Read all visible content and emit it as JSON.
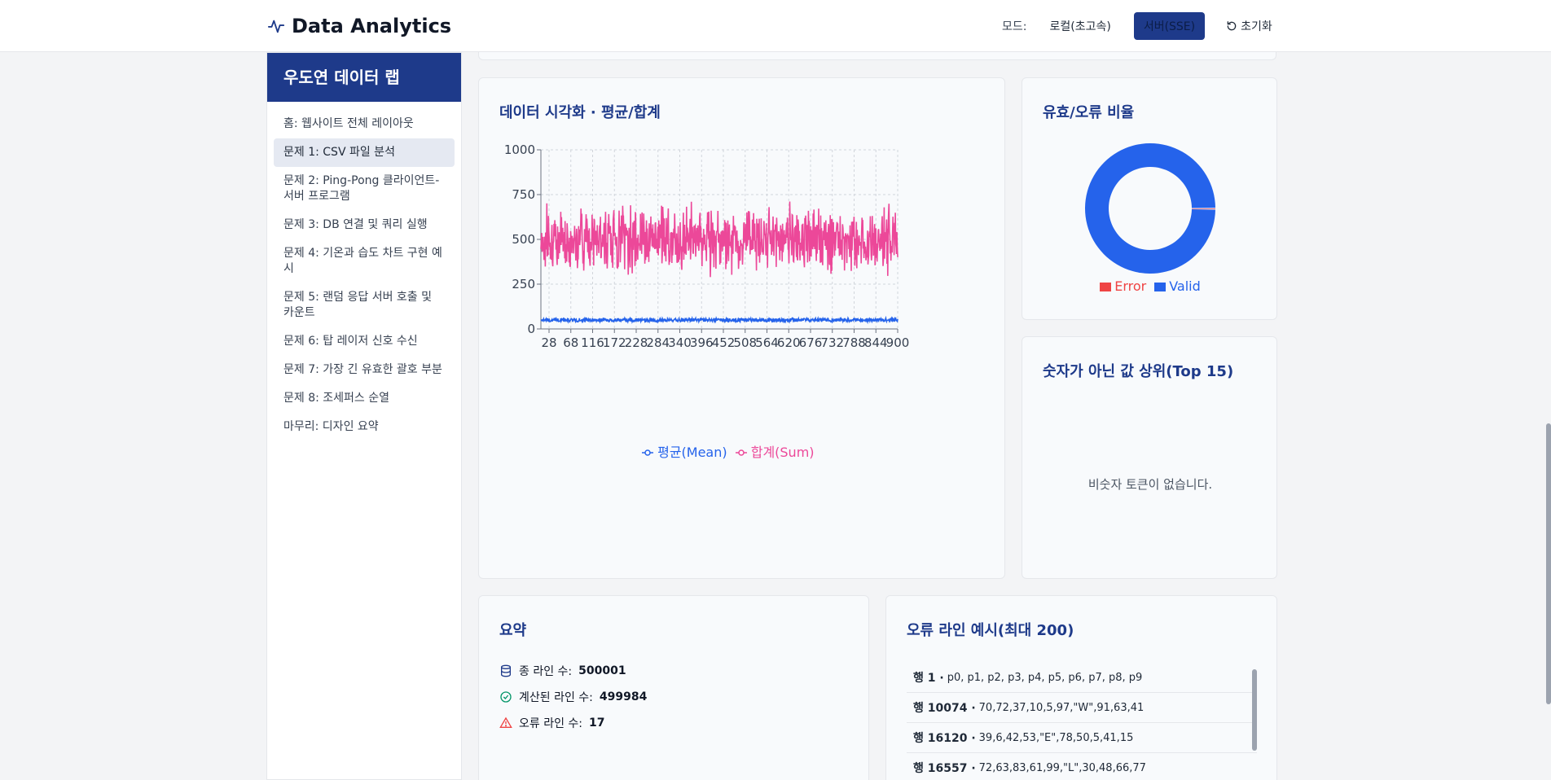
{
  "app": {
    "title": "Data Analytics"
  },
  "mode": {
    "label": "모드:",
    "local": "로컬(초고속)",
    "server": "서버(SSE)",
    "reset": "초기화"
  },
  "sidebar": {
    "title": "우도연 데이터 랩",
    "items": [
      {
        "label": "홈: 웹사이트 전체 레이아웃"
      },
      {
        "label": "문제 1: CSV 파일 분석"
      },
      {
        "label": "문제 2: Ping-Pong 클라이언트-서버 프로그램"
      },
      {
        "label": "문제 3: DB 연결 및 쿼리 실행"
      },
      {
        "label": "문제 4: 기온과 습도 차트 구현 예시"
      },
      {
        "label": "문제 5: 랜덤 응답 서버 호출 및 카운트"
      },
      {
        "label": "문제 6: 탑 레이저 신호 수신"
      },
      {
        "label": "문제 7: 가장 긴 유효한 괄호 부분"
      },
      {
        "label": "문제 8: 조세퍼스 순열"
      },
      {
        "label": "마무리: 디자인 요약"
      }
    ]
  },
  "viz": {
    "title": "데이터 시각화 · 평균/합계",
    "legend_mean": "평균(Mean)",
    "legend_sum": "합계(Sum)",
    "color_mean": "#2563eb",
    "color_sum": "#ec4899"
  },
  "chart_data": {
    "type": "line",
    "xlim": [
      0,
      900
    ],
    "ylim": [
      0,
      1000
    ],
    "yticks": [
      "0",
      "250",
      "500",
      "750",
      "1000"
    ],
    "xticks": [
      "28",
      "68",
      "116",
      "172",
      "228",
      "284",
      "340",
      "396",
      "452",
      "508",
      "564",
      "620",
      "676",
      "732",
      "788",
      "844",
      "900"
    ],
    "series": [
      {
        "name": "평균(Mean)",
        "level": 50,
        "spread": 10
      },
      {
        "name": "합계(Sum)",
        "level": 500,
        "spread": 100
      }
    ],
    "grid": true,
    "legend": "bottom"
  },
  "ratio": {
    "title": "유효/오류 비율",
    "error_label": "Error",
    "valid_label": "Valid",
    "error_count": 17,
    "valid_count": 499984,
    "error_color": "#ef4444",
    "valid_color": "#2563eb"
  },
  "nonnum": {
    "title": "숫자가 아닌 값 상위(Top 15)",
    "empty": "비숫자 토큰이 없습니다."
  },
  "summary": {
    "title": "요약",
    "total_label": "종 라인 수:",
    "total_value": "500001",
    "computed_label": "계산된 라인 수:",
    "computed_value": "499984",
    "error_label": "오류 라인 수:",
    "error_value": "17"
  },
  "errors": {
    "title": "오류 라인 예시(최대 200)",
    "rows": [
      {
        "line": "행 1 ·",
        "data": "p0, p1, p2, p3, p4, p5, p6, p7, p8, p9"
      },
      {
        "line": "행 10074 ·",
        "data": "70,72,37,10,5,97,\"W\",91,63,41"
      },
      {
        "line": "행 16120 ·",
        "data": "39,6,42,53,\"E\",78,50,5,41,15"
      },
      {
        "line": "행 16557 ·",
        "data": "72,63,83,61,99,\"L\",30,48,66,77"
      }
    ]
  }
}
